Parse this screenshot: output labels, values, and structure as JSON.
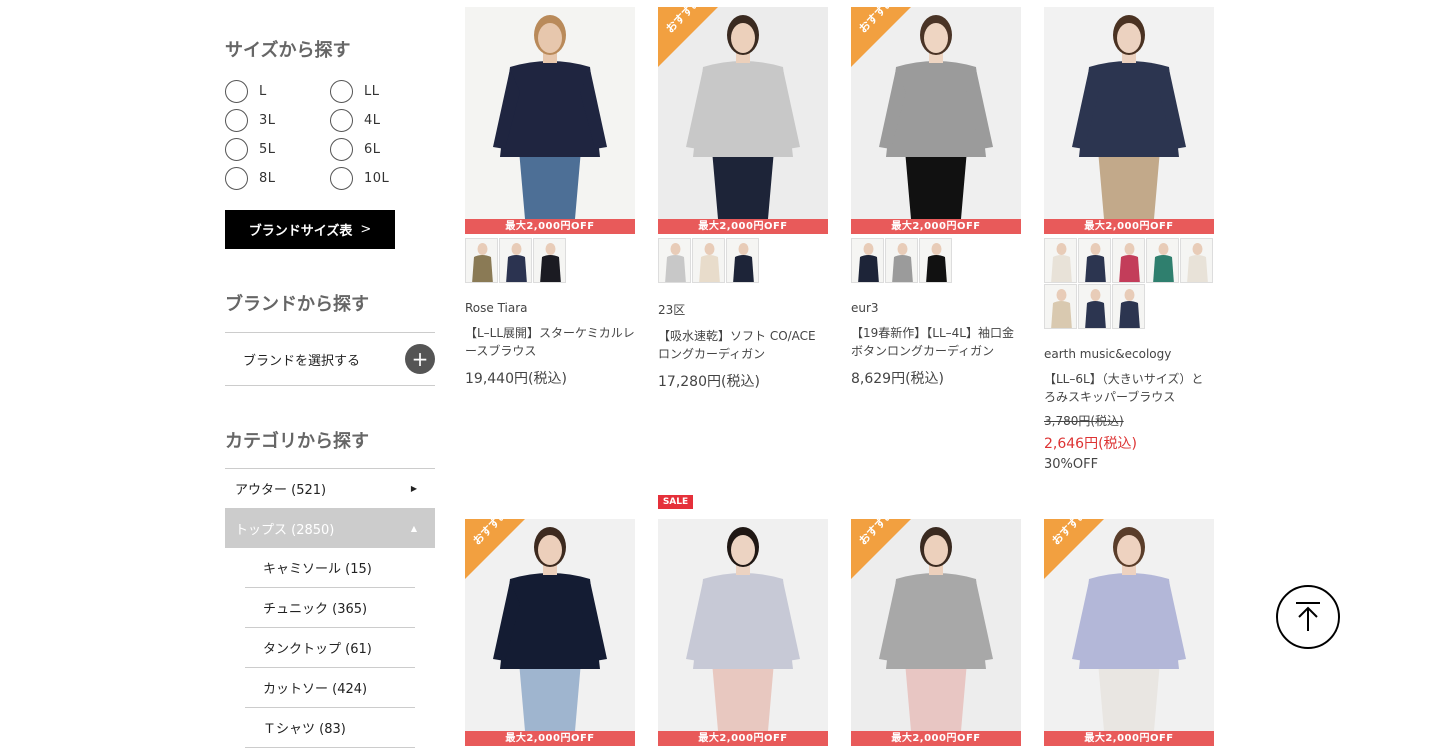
{
  "sidebar": {
    "size_title": "サイズから探す",
    "sizes": [
      "L",
      "LL",
      "3L",
      "4L",
      "5L",
      "6L",
      "8L",
      "10L"
    ],
    "brand_size_button": "ブランドサイズ表",
    "brand_size_arrow": ">",
    "brand_title": "ブランドから探す",
    "brand_select_label": "ブランドを選択する",
    "category_title": "カテゴリから探す",
    "categories": [
      {
        "label": "アウター (521)",
        "indicator": "▶"
      },
      {
        "label": "トップス (2850)",
        "indicator": "▲"
      }
    ],
    "subcategories": [
      "キャミソール (15)",
      "チュニック (365)",
      "タンクトップ (61)",
      "カットソー (424)",
      "Ｔシャツ (83)"
    ]
  },
  "products": [
    {
      "brand": "Rose Tiara",
      "name": "【L–LL展開】スターケミカルレースブラウス",
      "price": "19,440円(税込)",
      "banner": "最大2,000円OFF",
      "recommended": false,
      "colors": {
        "bg": "#f4f4f2",
        "top": "#1f2540",
        "bottom": "#4d6f96",
        "skin": "#e7c7ad",
        "hair": "#b98a5a"
      },
      "thumbs": [
        "#8a7a55",
        "#2b3350",
        "#1b1b22"
      ]
    },
    {
      "brand": "23区",
      "name": "【吸水速乾】ソフト CO/ACE ロングカーディガン",
      "price": "17,280円(税込)",
      "banner": "最大2,000円OFF",
      "recommended": true,
      "colors": {
        "bg": "#ececec",
        "top": "#c8c8c8",
        "bottom": "#1d2438",
        "skin": "#ecd0bb",
        "hair": "#3a2a20"
      },
      "thumbs": [
        "#c8c8c8",
        "#e8dccb",
        "#1d2438"
      ]
    },
    {
      "brand": "eur3",
      "name": "【19春新作】【LL–4L】袖口金ボタンロングカーディガン",
      "price": "8,629円(税込)",
      "banner": "最大2,000円OFF",
      "recommended": true,
      "colors": {
        "bg": "#efefef",
        "top": "#9b9b9b",
        "bottom": "#111111",
        "skin": "#eed5c2",
        "hair": "#4a3426"
      },
      "thumbs": [
        "#1d2438",
        "#9b9b9b",
        "#111111"
      ]
    },
    {
      "brand": "earth music&ecology",
      "name": "【LL–6L】（大きいサイズ）とろみスキッパーブラウス",
      "old_price": "3,780円(税込)",
      "sale_price": "2,646円(税込)",
      "off": "30%OFF",
      "banner": "最大2,000円OFF",
      "recommended": false,
      "colors": {
        "bg": "#f2f2f2",
        "top": "#2c3550",
        "bottom": "#c2a98a",
        "skin": "#ecd2c0",
        "hair": "#4a3222"
      },
      "thumbs": [
        "#e8e2d8",
        "#2c3550",
        "#c33d5a",
        "#2f7f6e",
        "#e8e2d8",
        "#d9c9b0",
        "#2c3550",
        "#2c3550"
      ]
    },
    {
      "banner": "最大2,000円OFF",
      "recommended": true,
      "colors": {
        "bg": "#f1f1f1",
        "top": "#141c33",
        "bottom": "#9fb5cf",
        "skin": "#eccfbb",
        "hair": "#3d2a1f"
      }
    },
    {
      "banner": "最大2,000円OFF",
      "recommended": false,
      "sale": "SALE",
      "colors": {
        "bg": "#f0f0f0",
        "top": "#c7c9d6",
        "bottom": "#e8c8c0",
        "skin": "#ecd3c2",
        "hair": "#1f1714"
      }
    },
    {
      "banner": "最大2,000円OFF",
      "recommended": true,
      "colors": {
        "bg": "#ededed",
        "top": "#a8a8a8",
        "bottom": "#e8c6c3",
        "skin": "#ecd0bc",
        "hair": "#3a2a20"
      }
    },
    {
      "banner": "最大2,000円OFF",
      "recommended": true,
      "colors": {
        "bg": "#f1f1f1",
        "top": "#b3b7d8",
        "bottom": "#e9e6e2",
        "skin": "#eed2c0",
        "hair": "#5a3d2a"
      }
    }
  ],
  "recommended_label": "おすすめ"
}
